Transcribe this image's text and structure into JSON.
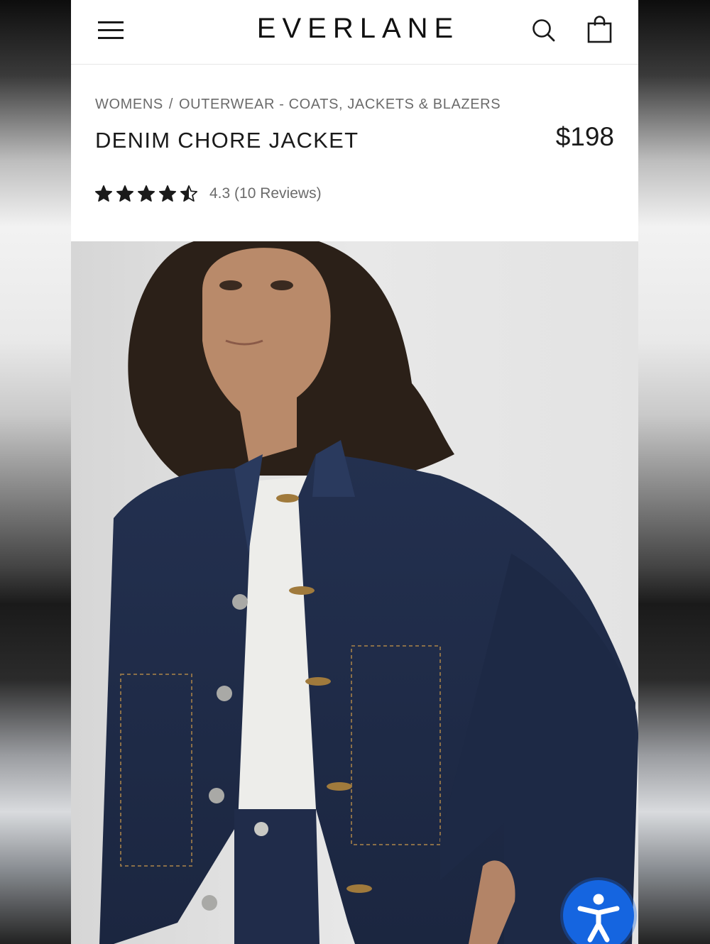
{
  "brand": "EVERLANE",
  "header": {
    "menu_icon": "hamburger-menu-icon",
    "search_icon": "search-icon",
    "bag_icon": "shopping-bag-icon"
  },
  "breadcrumb": {
    "items": [
      "WOMENS",
      "OUTERWEAR - COATS, JACKETS & BLAZERS"
    ],
    "separator": "/"
  },
  "product": {
    "title": "DENIM CHORE JACKET",
    "price": "$198",
    "rating": 4.3,
    "rating_text": "4.3 (10 Reviews)",
    "image_icon": "product-photo"
  },
  "accessibility": {
    "icon": "accessibility-icon",
    "color": "#1565e0"
  },
  "colors": {
    "text": "#1a1a1a",
    "muted": "#6b6b6b",
    "denim": "#1f2d4d"
  }
}
